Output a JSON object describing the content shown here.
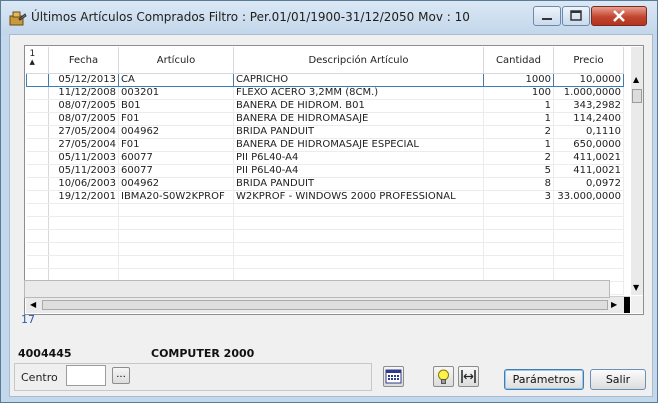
{
  "window": {
    "title": "Últimos Artículos Comprados Filtro : Per.01/01/1900-31/12/2050 Mov : 10",
    "accent": "#c3d8ec"
  },
  "grid": {
    "sort_marker": "1",
    "columns": [
      "Fecha",
      "Artículo",
      "Descripción Artículo",
      "Cantidad",
      "Precio"
    ],
    "rows": [
      [
        "05/12/2013",
        "CA",
        "CAPRICHO",
        "1000",
        "10,0000"
      ],
      [
        "11/12/2008",
        "003201",
        "FLEXO ACERO 3,2MM (8CM.)",
        "100",
        "1.000,0000"
      ],
      [
        "08/07/2005",
        "B01",
        "BAÑERA DE HIDROM. B01",
        "1",
        "343,2982"
      ],
      [
        "08/07/2005",
        "F01",
        "BAÑERA DE HIDROMASAJE",
        "1",
        "114,2400"
      ],
      [
        "27/05/2004",
        "004962",
        "BRIDA PANDUIT",
        "2",
        "0,1110"
      ],
      [
        "27/05/2004",
        "F01",
        "BAÑERA DE HIDROMASAJE ESPECIAL",
        "1",
        "650,0000"
      ],
      [
        "05/11/2003",
        "60077",
        "PII P6L40-A4",
        "2",
        "411,0021"
      ],
      [
        "05/11/2003",
        "60077",
        "PII P6L40-A4",
        "5",
        "411,0021"
      ],
      [
        "10/06/2003",
        "004962",
        "BRIDA PANDUIT",
        "8",
        "0,0972"
      ],
      [
        "19/12/2001",
        "IBMA20-S0W2KPROF",
        "W2KPROF - WINDOWS 2000 PROFESSIONAL",
        "3",
        "33.000,0000"
      ]
    ]
  },
  "record_count": "17",
  "customer": {
    "code": "4004445",
    "name": "COMPUTER 2000"
  },
  "filters": {
    "centro_label": "Centro",
    "centro_value": "",
    "browse_label": "..."
  },
  "buttons": {
    "parametros": "Parámetros",
    "salir": "Salir"
  }
}
